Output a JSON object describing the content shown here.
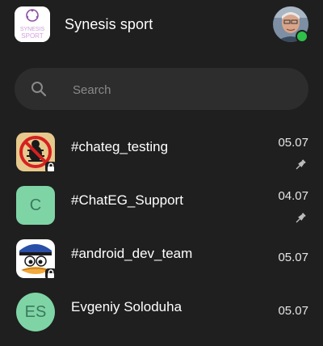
{
  "header": {
    "org_name": "Synesis sport",
    "org_logo_text_top": "SYNESIS",
    "org_logo_text_bottom": "SPORT",
    "user_status": "online"
  },
  "search": {
    "placeholder": "Search",
    "value": ""
  },
  "chats": [
    {
      "name": "#chateg_testing",
      "date": "05.07",
      "pinned": true,
      "locked": true,
      "avatar": "no-bugs-icon"
    },
    {
      "name": "#ChatEG_Support",
      "date": "04.07",
      "pinned": true,
      "locked": false,
      "avatar_letter": "C"
    },
    {
      "name": "#android_dev_team",
      "date": "05.07",
      "pinned": false,
      "locked": true,
      "avatar": "duck-icon"
    },
    {
      "name": "Evgeniy Soloduha",
      "date": "05.07",
      "pinned": false,
      "locked": false,
      "avatar_letter": "ES"
    }
  ],
  "colors": {
    "background": "#1f1f1f",
    "search_background": "#2d2d2d",
    "letter_avatar": "#7fd4a6",
    "online": "#2fbf4a"
  }
}
